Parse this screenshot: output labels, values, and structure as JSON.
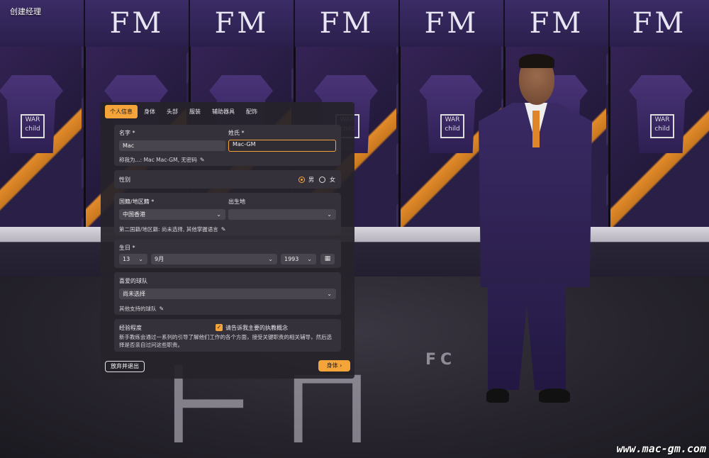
{
  "window": {
    "title": "创建经理"
  },
  "tabs": [
    "个人信息",
    "身体",
    "头部",
    "服装",
    "辅助器具",
    "配饰"
  ],
  "name_section": {
    "first_name_label": "名字",
    "first_name_value": "Mac",
    "last_name_label": "姓氏",
    "last_name_value": "Mac-GM",
    "call_me_hint": "称我为...: Mac Mac-GM, 无密码"
  },
  "gender": {
    "label": "性别",
    "male": "男",
    "female": "女",
    "selected": "男"
  },
  "nationality": {
    "label": "国籍/地区籍",
    "value": "中国香港",
    "birthplace_label": "出生地",
    "birthplace_value": "",
    "second_hint": "第二国籍/地区籍: 尚未选择, 其他掌握语言"
  },
  "birthday": {
    "label": "生日",
    "day": "13",
    "month": "9月",
    "year": "1993"
  },
  "favorite_team": {
    "label": "喜爱的球队",
    "value": "尚未选择",
    "other_hint": "其他支持的球队"
  },
  "experience": {
    "label": "经验程度",
    "checkbox_label": "请告诉我主要的执教概念",
    "checked": true,
    "description": "新手教练会通过一系列的引导了解他们工作的各个方面，接受关键职责的相关辅导，然后选择是否亲自过问这些职责。"
  },
  "buttons": {
    "quit": "放弃并退出",
    "next": "身体"
  },
  "background": {
    "banner_text": "FM",
    "jersey_badge": "WAR child",
    "floor_text": "FC"
  },
  "watermark": "www.mac-gm.com",
  "colors": {
    "accent": "#f5a43a",
    "panel": "#26232a",
    "card": "#34313a"
  },
  "icons": [
    "pencil-icon",
    "chevron-down-icon",
    "calendar-icon",
    "chevron-right-icon",
    "check-icon"
  ]
}
